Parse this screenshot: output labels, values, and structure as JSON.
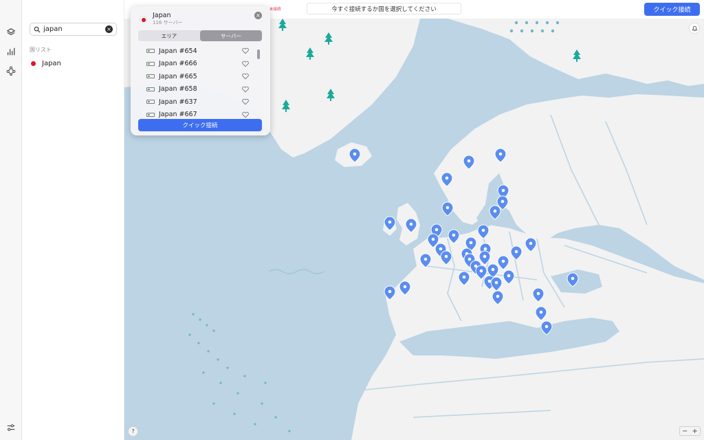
{
  "topbar": {
    "status_tag": "未接続",
    "status_text": "今すぐ接続するか国を選択してください",
    "quick_connect": "クイック接続"
  },
  "rail": {
    "icons": [
      "layers-icon",
      "stats-icon",
      "meshnet-icon",
      "settings-sliders-icon"
    ]
  },
  "sidebar": {
    "search_value": "japan",
    "clear_glyph": "×",
    "list_header": "国リスト",
    "countries": [
      {
        "name": "Japan",
        "flag_color": "#e4142b"
      }
    ]
  },
  "popover": {
    "title": "Japan",
    "subtitle": "116 サーバー",
    "close_glyph": "×",
    "tabs": [
      {
        "label": "エリア",
        "active": false
      },
      {
        "label": "サーバー",
        "active": true
      }
    ],
    "servers": [
      {
        "name": "Japan #654"
      },
      {
        "name": "Japan #666"
      },
      {
        "name": "Japan #665"
      },
      {
        "name": "Japan #658"
      },
      {
        "name": "Japan #637"
      },
      {
        "name": "Japan #667"
      }
    ],
    "quick_connect": "クイック接続"
  },
  "map": {
    "help_glyph": "?",
    "zoom_out": "−",
    "zoom_in": "+",
    "colors": {
      "sea": "#bcd4e4",
      "land": "#f2f2f2",
      "pin": "#5b8def",
      "tree": "#1ba99a",
      "accent": "#3e6ef0"
    }
  }
}
